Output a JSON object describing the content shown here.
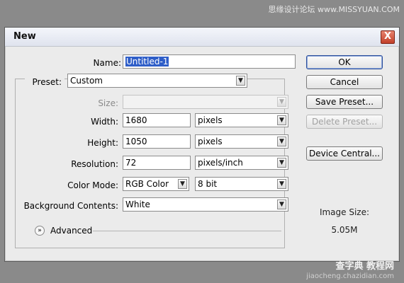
{
  "watermark_top": "思缘设计论坛 www.MISSYUAN.COM",
  "watermark_bottom": {
    "line1": "查字典 教程网",
    "line2": "jiaocheng.chazidian.com"
  },
  "dialog": {
    "title": "New",
    "close_label": "X",
    "name": {
      "label": "Name:",
      "value": "Untitled-1"
    },
    "preset": {
      "label": "Preset:",
      "value": "Custom"
    },
    "size": {
      "label": "Size:",
      "value": ""
    },
    "width": {
      "label": "Width:",
      "value": "1680",
      "unit": "pixels"
    },
    "height": {
      "label": "Height:",
      "value": "1050",
      "unit": "pixels"
    },
    "resolution": {
      "label": "Resolution:",
      "value": "72",
      "unit": "pixels/inch"
    },
    "color_mode": {
      "label": "Color Mode:",
      "value": "RGB Color",
      "depth": "8 bit"
    },
    "background": {
      "label": "Background Contents:",
      "value": "White"
    },
    "advanced_label": "Advanced",
    "buttons": {
      "ok": "OK",
      "cancel": "Cancel",
      "save_preset": "Save Preset...",
      "delete_preset": "Delete Preset...",
      "device_central": "Device Central..."
    },
    "image_size": {
      "label": "Image Size:",
      "value": "5.05M"
    }
  },
  "colors": {
    "background": "#8a8a8a",
    "dialog": "#ebebeb",
    "selection": "#2f5ec8",
    "close": "#c2402a"
  },
  "icons": {
    "close": "close-icon",
    "dropdown": "chevron-down-icon",
    "advanced": "double-chevron-down-icon"
  }
}
